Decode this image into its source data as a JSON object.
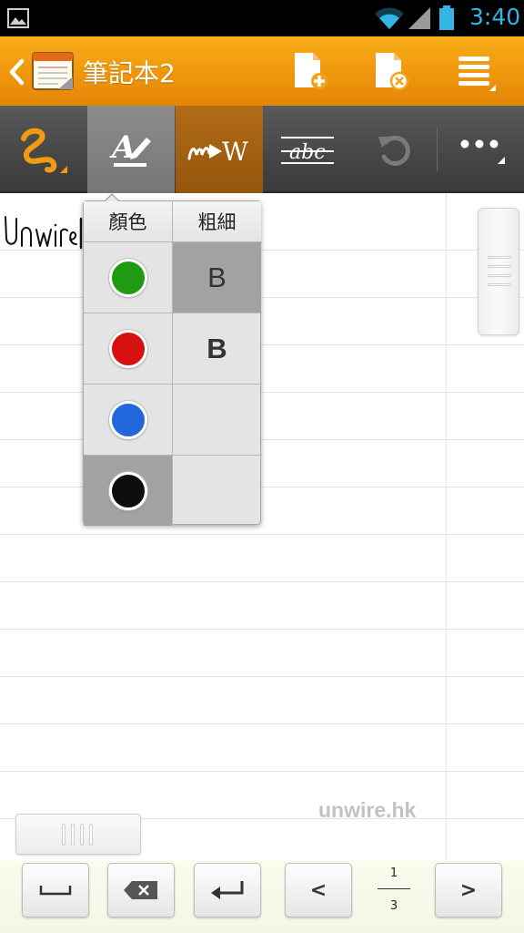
{
  "status_bar": {
    "time": "3:40",
    "icons": [
      "image-notification-icon",
      "wifi-icon",
      "signal-icon",
      "battery-icon"
    ]
  },
  "app_bar": {
    "title": "筆記本2",
    "actions": [
      "new-page-icon",
      "delete-page-icon",
      "menu-icon"
    ]
  },
  "toolbar": {
    "tools": [
      "pen-icon",
      "text-style-icon",
      "handwriting-to-text-icon",
      "strikethrough-abc-icon",
      "undo-icon",
      "more-icon"
    ],
    "active_tool": "text-style-icon"
  },
  "note": {
    "handwriting": "Unwire",
    "watermark": "unwire.hk"
  },
  "popup": {
    "color_header": "顏色",
    "width_header": "粗細",
    "colors": [
      {
        "name": "green",
        "hex": "#1f9b12"
      },
      {
        "name": "red",
        "hex": "#d7110f"
      },
      {
        "name": "blue",
        "hex": "#2168dc"
      },
      {
        "name": "black",
        "hex": "#0d0d0d"
      }
    ],
    "selected_color": "black",
    "widths": [
      {
        "label": "B",
        "weight": "thin"
      },
      {
        "label": "B",
        "weight": "bold"
      }
    ],
    "selected_width": "thin"
  },
  "bottom_bar": {
    "buttons": [
      "space-icon",
      "backspace-icon",
      "enter-icon",
      "previous-page-button",
      "next-page-button"
    ],
    "page_current": "1",
    "page_total": "3",
    "prev_label": "<",
    "next_label": ">"
  },
  "colors": {
    "app_bar": "#f0980d",
    "toolbar": "#474747",
    "accent": "#33b5e5",
    "pen": "#f29a12"
  }
}
